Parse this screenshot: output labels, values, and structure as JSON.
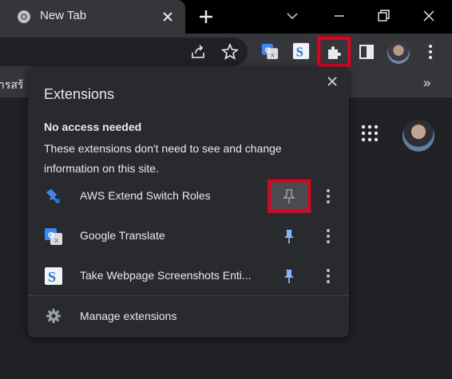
{
  "tab": {
    "title": "New Tab"
  },
  "bookmarks": {
    "partial_text": "ารสร้",
    "more": "»"
  },
  "popup": {
    "title": "Extensions",
    "section_heading": "No access needed",
    "section_description": "These extensions don't need to see and change information on this site.",
    "extensions": [
      {
        "name": "AWS Extend Switch Roles",
        "icon": "aws-key-icon",
        "pinned": false
      },
      {
        "name": "Google Translate",
        "icon": "google-translate-icon",
        "pinned": true
      },
      {
        "name": "Take Webpage Screenshots Enti...",
        "icon": "screenshot-s-icon",
        "pinned": true
      }
    ],
    "manage_label": "Manage extensions"
  },
  "colors": {
    "highlight": "#e2001a",
    "pin_active": "#8ab4f8",
    "pin_inactive": "#9aa0a6",
    "popup_bg": "#292a2d",
    "toolbar_bg": "#35363a"
  }
}
